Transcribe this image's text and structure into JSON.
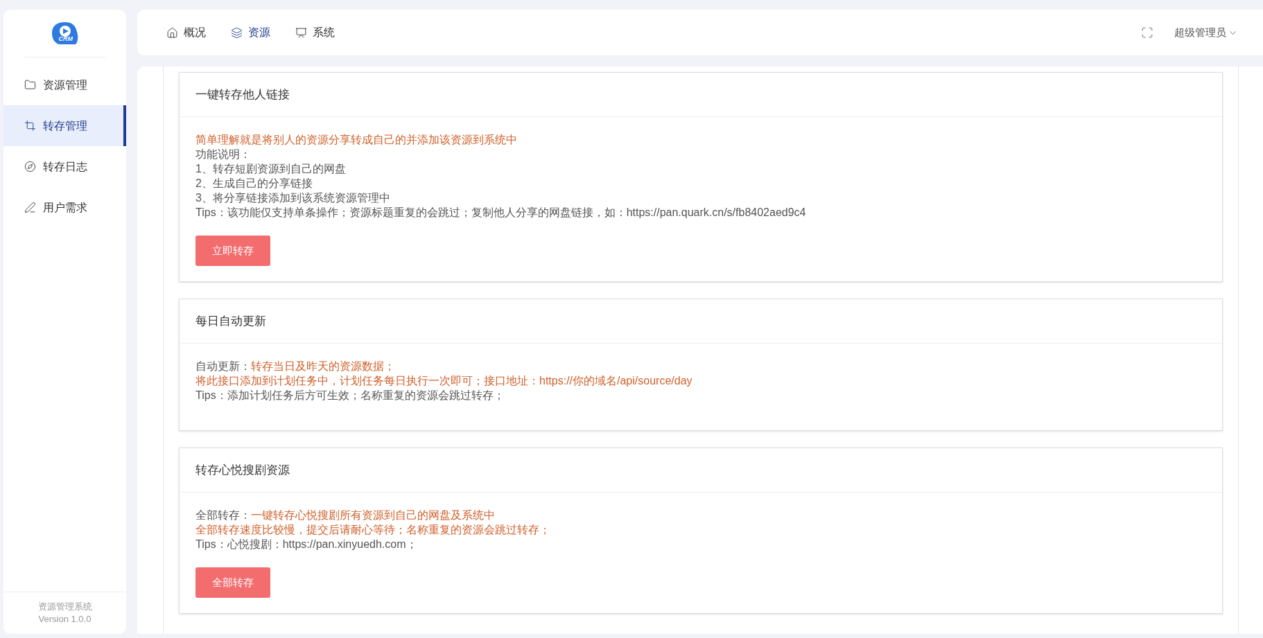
{
  "logo": {
    "text": "CRM"
  },
  "sidebar": {
    "items": [
      {
        "label": "资源管理",
        "selected": false
      },
      {
        "label": "转存管理",
        "selected": true
      },
      {
        "label": "转存日志",
        "selected": false
      },
      {
        "label": "用户需求",
        "selected": false
      }
    ],
    "footer": [
      "资源管理系统",
      "Version 1.0.0"
    ]
  },
  "topnav": {
    "tabs": [
      {
        "label": "概况",
        "selected": false
      },
      {
        "label": "资源",
        "selected": true
      },
      {
        "label": "系统",
        "selected": false
      }
    ],
    "user": "超级管理员"
  },
  "cards": [
    {
      "title": "一键转存他人链接",
      "lines": [
        [
          {
            "text": "简单理解就是将别人的资源分享转成自己的并添加该资源到系统中",
            "highlight": true
          }
        ],
        [
          {
            "text": "功能说明：",
            "highlight": false
          }
        ],
        [
          {
            "text": "1、转存短剧资源到自己的网盘",
            "highlight": false
          }
        ],
        [
          {
            "text": "2、生成自己的分享链接",
            "highlight": false
          }
        ],
        [
          {
            "text": "3、将分享链接添加到该系统资源管理中",
            "highlight": false
          }
        ],
        [
          {
            "text": "Tips：该功能仅支持单条操作；资源标题重复的会跳过；复制他人分享的网盘链接，如：https://pan.quark.cn/s/fb8402aed9c4",
            "highlight": false
          }
        ]
      ],
      "button": "立即转存"
    },
    {
      "title": "每日自动更新",
      "lines": [
        [
          {
            "text": "自动更新：",
            "highlight": false
          },
          {
            "text": "转存当日及昨天的资源数据；",
            "highlight": true
          }
        ],
        [
          {
            "text": "将此接口添加到计划任务中，计划任务每日执行一次即可；接口地址：https://你的域名/api/source/day",
            "highlight": true
          }
        ],
        [
          {
            "text": "Tips：添加计划任务后方可生效；名称重复的资源会跳过转存；",
            "highlight": false
          }
        ]
      ]
    },
    {
      "title": "转存心悦搜剧资源",
      "lines": [
        [
          {
            "text": "全部转存：",
            "highlight": false
          },
          {
            "text": "一键转存心悦搜剧所有资源到自己的网盘及系统中",
            "highlight": true
          }
        ],
        [
          {
            "text": "全部转存速度比较慢，提交后请耐心等待；名称重复的资源会跳过转存；",
            "highlight": true
          }
        ],
        [
          {
            "text": "Tips：心悦搜剧：https://pan.xinyuedh.com；",
            "highlight": false
          }
        ]
      ],
      "button": "全部转存"
    }
  ]
}
